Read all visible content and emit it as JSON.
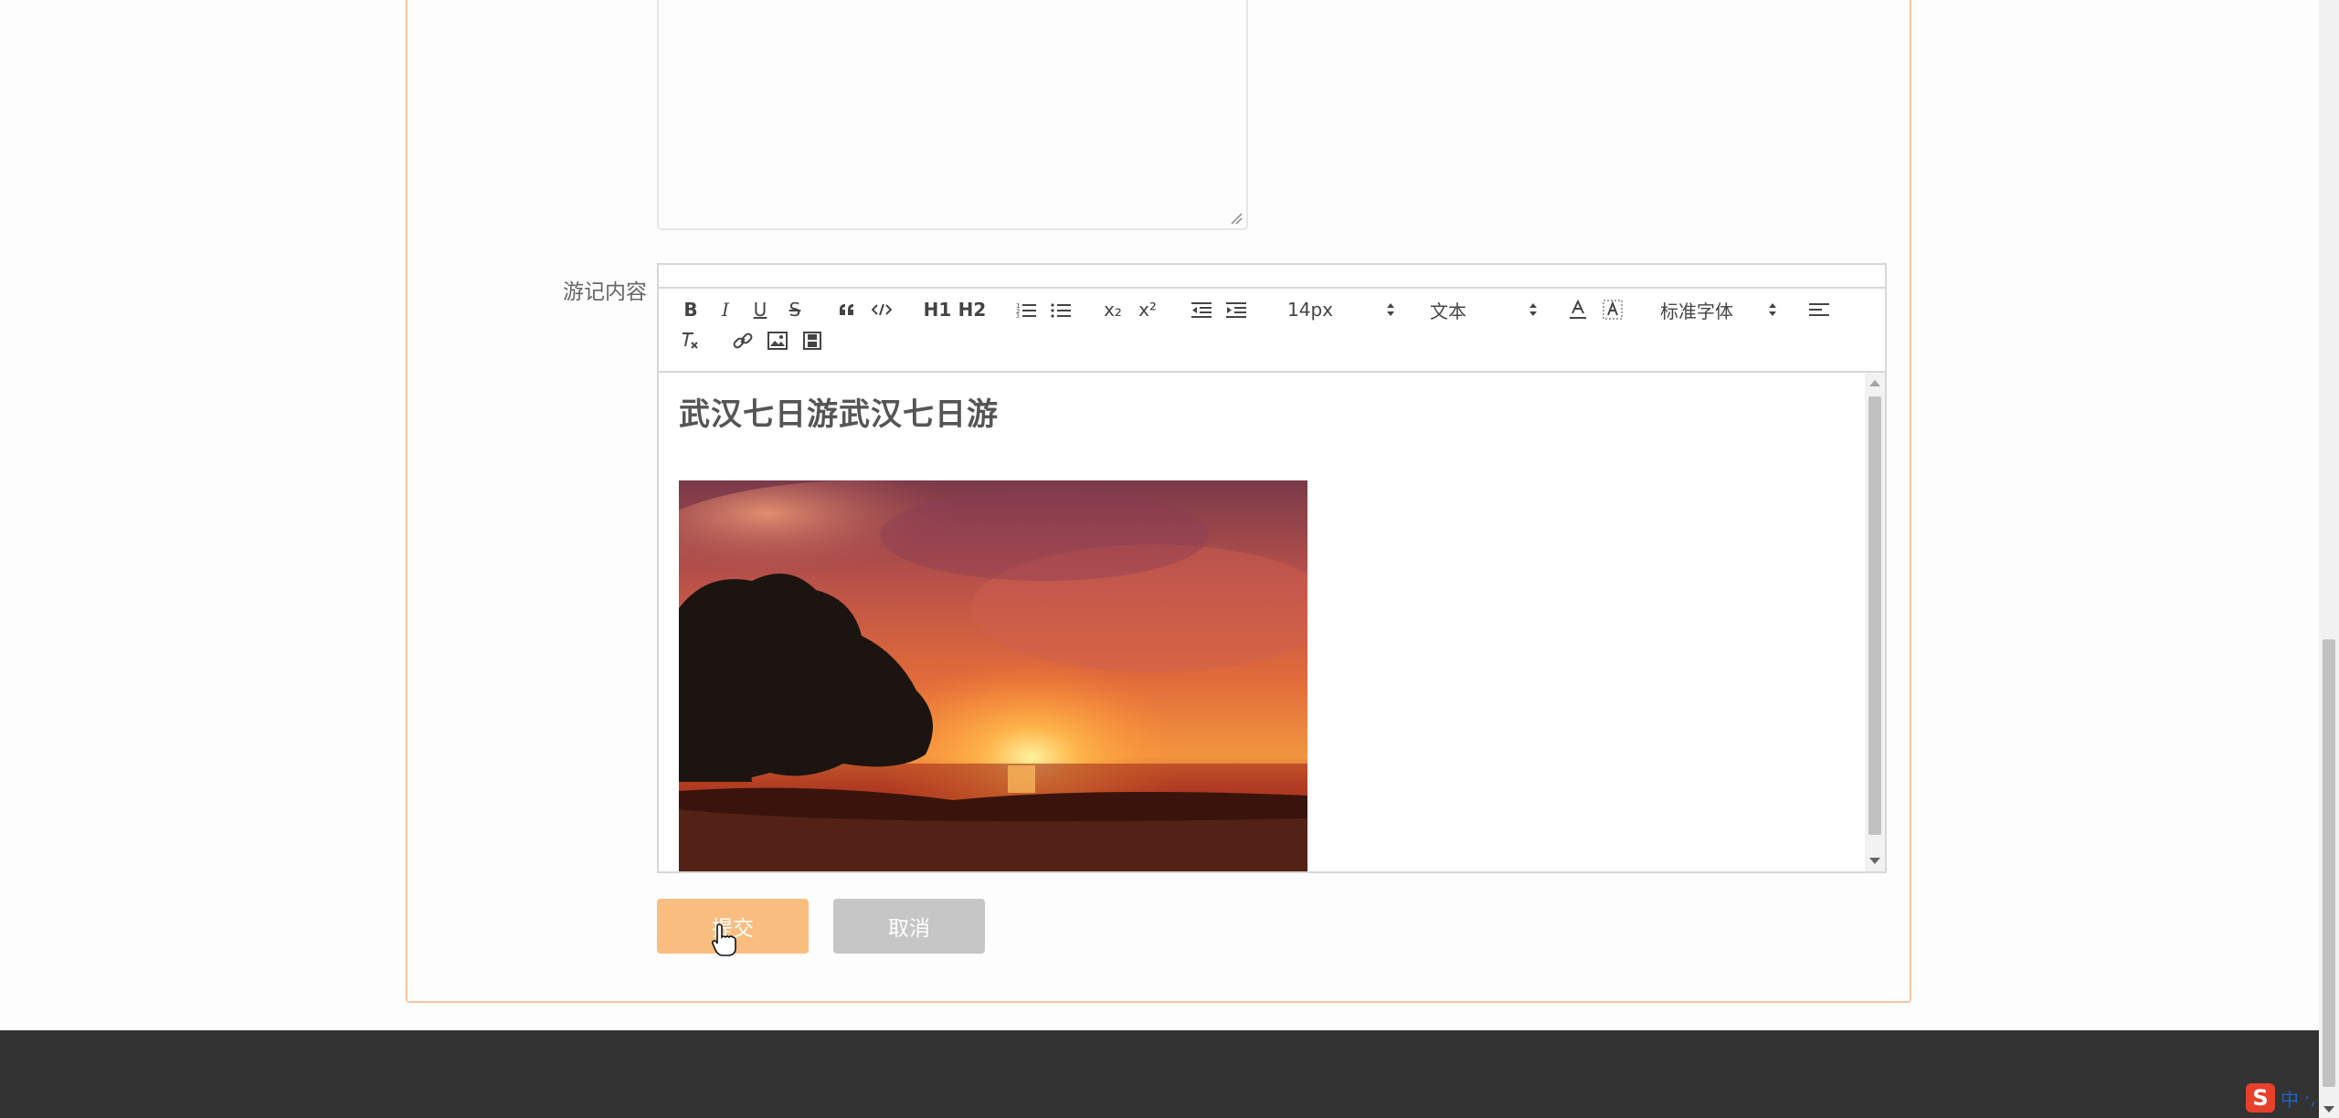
{
  "form": {
    "content_label": "游记内容",
    "submit_label": "提交",
    "cancel_label": "取消"
  },
  "editor": {
    "toolbar": {
      "bold": "B",
      "italic": "I",
      "underline": "U",
      "strike": "S",
      "subscript": "x₂",
      "superscript": "x²",
      "font_size": "14px",
      "block_type": "文本",
      "font_family": "标准字体",
      "header1": "H1",
      "header2": "H2"
    },
    "content": {
      "title_text": "武汉七日游武汉七日游",
      "image_desc": "sunset-beach-photo"
    }
  },
  "colors": {
    "accent": "#f9bd80",
    "card_border": "#f5c5a0",
    "cancel": "#c6c6c6",
    "footer": "#333333"
  },
  "ime": {
    "logo": "S",
    "mode": "中",
    "extra": "·,"
  }
}
